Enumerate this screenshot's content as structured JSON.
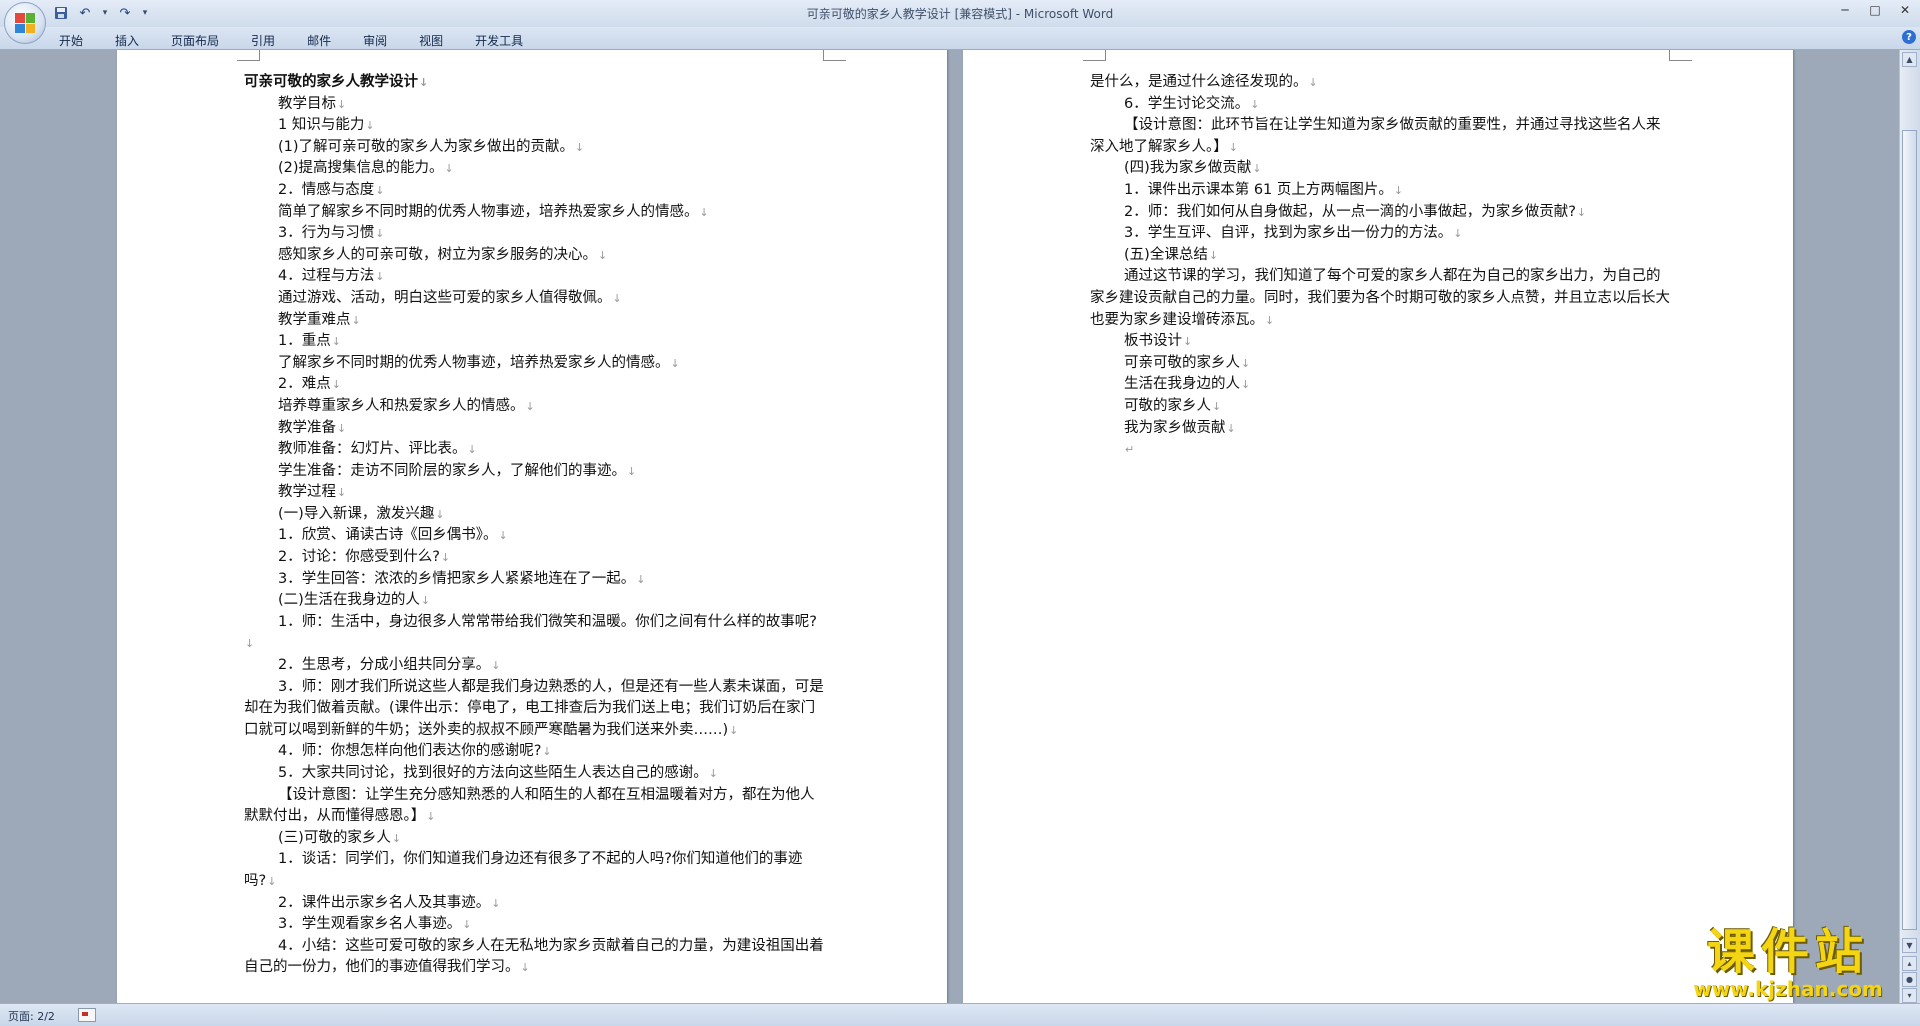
{
  "window": {
    "title": "可亲可敬的家乡人教学设计 [兼容模式] - Microsoft Word",
    "controls": [
      "─",
      "□",
      "✕"
    ]
  },
  "ribbon": {
    "tabs": [
      "开始",
      "插入",
      "页面布局",
      "引用",
      "邮件",
      "审阅",
      "视图",
      "开发工具"
    ]
  },
  "page1": {
    "lines": [
      {
        "text": "可亲可敬的家乡人教学设计",
        "indent": false,
        "bold": true
      },
      {
        "text": "教学目标",
        "indent": true
      },
      {
        "text": "1 知识与能力",
        "indent": true
      },
      {
        "text": "(1)了解可亲可敬的家乡人为家乡做出的贡献。",
        "indent": true
      },
      {
        "text": "(2)提高搜集信息的能力。",
        "indent": true
      },
      {
        "text": "2．情感与态度",
        "indent": true
      },
      {
        "text": "简单了解家乡不同时期的优秀人物事迹，培养热爱家乡人的情感。",
        "indent": true
      },
      {
        "text": "3．行为与习惯",
        "indent": true
      },
      {
        "text": "感知家乡人的可亲可敬，树立为家乡服务的决心。",
        "indent": true
      },
      {
        "text": "4．过程与方法",
        "indent": true
      },
      {
        "text": "通过游戏、活动，明白这些可爱的家乡人值得敬佩。",
        "indent": true
      },
      {
        "text": "教学重难点",
        "indent": true
      },
      {
        "text": "1．重点",
        "indent": true
      },
      {
        "text": "了解家乡不同时期的优秀人物事迹，培养热爱家乡人的情感。",
        "indent": true
      },
      {
        "text": "2．难点",
        "indent": true
      },
      {
        "text": "培养尊重家乡人和热爱家乡人的情感。",
        "indent": true
      },
      {
        "text": "教学准备",
        "indent": true
      },
      {
        "text": "教师准备：幻灯片、评比表。",
        "indent": true
      },
      {
        "text": "学生准备：走访不同阶层的家乡人，了解他们的事迹。",
        "indent": true
      },
      {
        "text": "教学过程",
        "indent": true
      },
      {
        "text": "(一)导入新课，激发兴趣",
        "indent": true
      },
      {
        "text": "1．欣赏、诵读古诗《回乡偶书》。",
        "indent": true
      },
      {
        "text": "2．讨论：你感受到什么?",
        "indent": true
      },
      {
        "text": "3．学生回答：浓浓的乡情把家乡人紧紧地连在了一起。",
        "indent": true
      },
      {
        "text": "(二)生活在我身边的人",
        "indent": true
      },
      {
        "text": "1．师：生活中，身边很多人常常带给我们微笑和温暖。你们之间有什么样的故事呢?",
        "indent": true
      },
      {
        "text": "2．生思考，分成小组共同分享。",
        "indent": true
      },
      {
        "text": "3．师：刚才我们所说这些人都是我们身边熟悉的人，但是还有一些人素未谋面，可是却在为我们做着贡献。(课件出示：停电了，电工排查后为我们送上电；我们订奶后在家门口就可以喝到新鲜的牛奶；送外卖的叔叔不顾严寒酷暑为我们送来外卖……)",
        "indent": true
      },
      {
        "text": "4．师：你想怎样向他们表达你的感谢呢?",
        "indent": true
      },
      {
        "text": "5．大家共同讨论，找到很好的方法向这些陌生人表达自己的感谢。",
        "indent": true
      },
      {
        "text": "【设计意图：让学生充分感知熟悉的人和陌生的人都在互相温暖着对方，都在为他人默默付出，从而懂得感恩。】",
        "indent": true
      },
      {
        "text": "(三)可敬的家乡人",
        "indent": true
      },
      {
        "text": "1．谈话：同学们，你们知道我们身边还有很多了不起的人吗?你们知道他们的事迹吗?",
        "indent": true
      },
      {
        "text": "2．课件出示家乡名人及其事迹。",
        "indent": true
      },
      {
        "text": "3．学生观看家乡名人事迹。",
        "indent": true
      },
      {
        "text": "4．小结：这些可爱可敬的家乡人在无私地为家乡贡献着自己的力量，为建设祖国出着自己的一份力，他们的事迹值得我们学习。",
        "indent": true
      }
    ]
  },
  "page2": {
    "lines": [
      {
        "text": "是什么，是通过什么途径发现的。",
        "indent": false
      },
      {
        "text": "6．学生讨论交流。",
        "indent": true
      },
      {
        "text": "【设计意图：此环节旨在让学生知道为家乡做贡献的重要性，并通过寻找这些名人来深入地了解家乡人。】",
        "indent": true
      },
      {
        "text": "(四)我为家乡做贡献",
        "indent": true
      },
      {
        "text": "1．课件出示课本第 61 页上方两幅图片。",
        "indent": true
      },
      {
        "text": "2．师：我们如何从自身做起，从一点一滴的小事做起，为家乡做贡献?",
        "indent": true
      },
      {
        "text": "3．学生互评、自评，找到为家乡出一份力的方法。",
        "indent": true
      },
      {
        "text": "(五)全课总结",
        "indent": true
      },
      {
        "text": "通过这节课的学习，我们知道了每个可爱的家乡人都在为自己的家乡出力，为自己的家乡建设贡献自己的力量。同时，我们要为各个时期可敬的家乡人点赞，并且立志以后长大也要为家乡建设增砖添瓦。",
        "indent": true
      },
      {
        "text": "板书设计",
        "indent": true
      },
      {
        "text": "可亲可敬的家乡人",
        "indent": true
      },
      {
        "text": "生活在我身边的人",
        "indent": true
      },
      {
        "text": "可敬的家乡人",
        "indent": true
      },
      {
        "text": "我为家乡做贡献",
        "indent": true
      }
    ]
  },
  "marks": {
    "paragraph": "↓",
    "end": "↵"
  },
  "status": {
    "page": "页面: 2/2"
  },
  "watermark": {
    "name": "课件站",
    "url": "www.kjzhan.com"
  },
  "colors": {
    "workspace": "#9da9b9",
    "accent": "#2f6fd1",
    "watermark": "#f3d514"
  }
}
